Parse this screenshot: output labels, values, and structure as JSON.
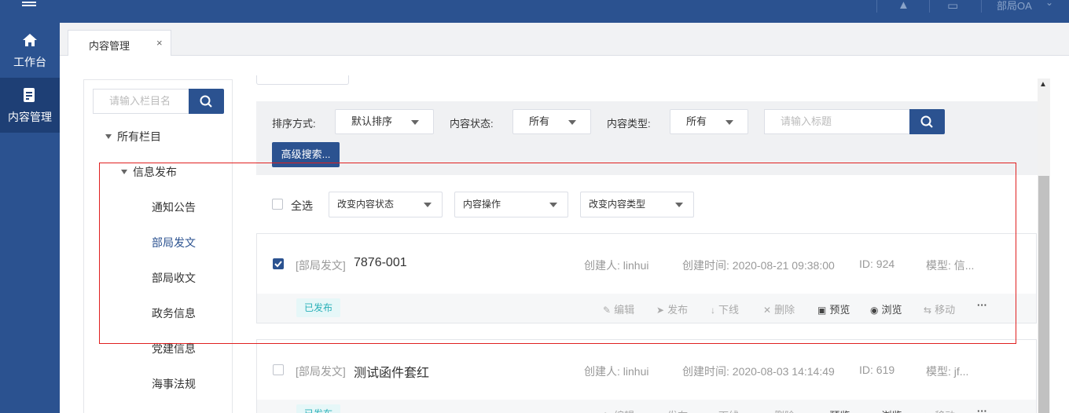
{
  "topbar": {
    "user": "部局OA",
    "bell_icon": "bell-icon",
    "monitor_icon": "monitor-icon"
  },
  "sidebar": {
    "items": [
      {
        "label": "工作台",
        "icon": "home-icon"
      },
      {
        "label": "内容管理",
        "icon": "document-edit-icon"
      }
    ]
  },
  "tabs": [
    {
      "label": "内容管理",
      "close": "×"
    }
  ],
  "tree": {
    "search_placeholder": "请输入栏目名",
    "root": "所有栏目",
    "group": "信息发布",
    "items": [
      "通知公告",
      "部局发文",
      "部局收文",
      "政务信息",
      "党建信息",
      "海事法规"
    ],
    "selected": "部局发文"
  },
  "filter": {
    "sort_label": "排序方式:",
    "sort_value": "默认排序",
    "status_label": "内容状态:",
    "status_value": "所有",
    "type_label": "内容类型:",
    "type_value": "所有",
    "title_placeholder": "请输入标题",
    "advanced": "高级搜索..."
  },
  "bulk": {
    "select_all": "全选",
    "change_status": "改变内容状态",
    "content_ops": "内容操作",
    "change_type": "改变内容类型"
  },
  "rows": [
    {
      "category": "[部局发文]",
      "title": "7876-001",
      "creator": "创建人: linhui",
      "created": "创建时间: 2020-08-21 09:38:00",
      "id": "ID: 924",
      "model": "模型: 信...",
      "status": "已发布",
      "checked": true
    },
    {
      "category": "[部局发文]",
      "title": "测试函件套红",
      "creator": "创建人: linhui",
      "created": "创建时间: 2020-08-03 14:14:49",
      "id": "ID: 619",
      "model": "模型: jf...",
      "status": "已发布",
      "checked": false
    }
  ],
  "actions": {
    "edit": "编辑",
    "publish": "发布",
    "offline": "下线",
    "delete": "删除",
    "preview": "预览",
    "browse": "浏览",
    "move": "移动",
    "more": "···"
  }
}
